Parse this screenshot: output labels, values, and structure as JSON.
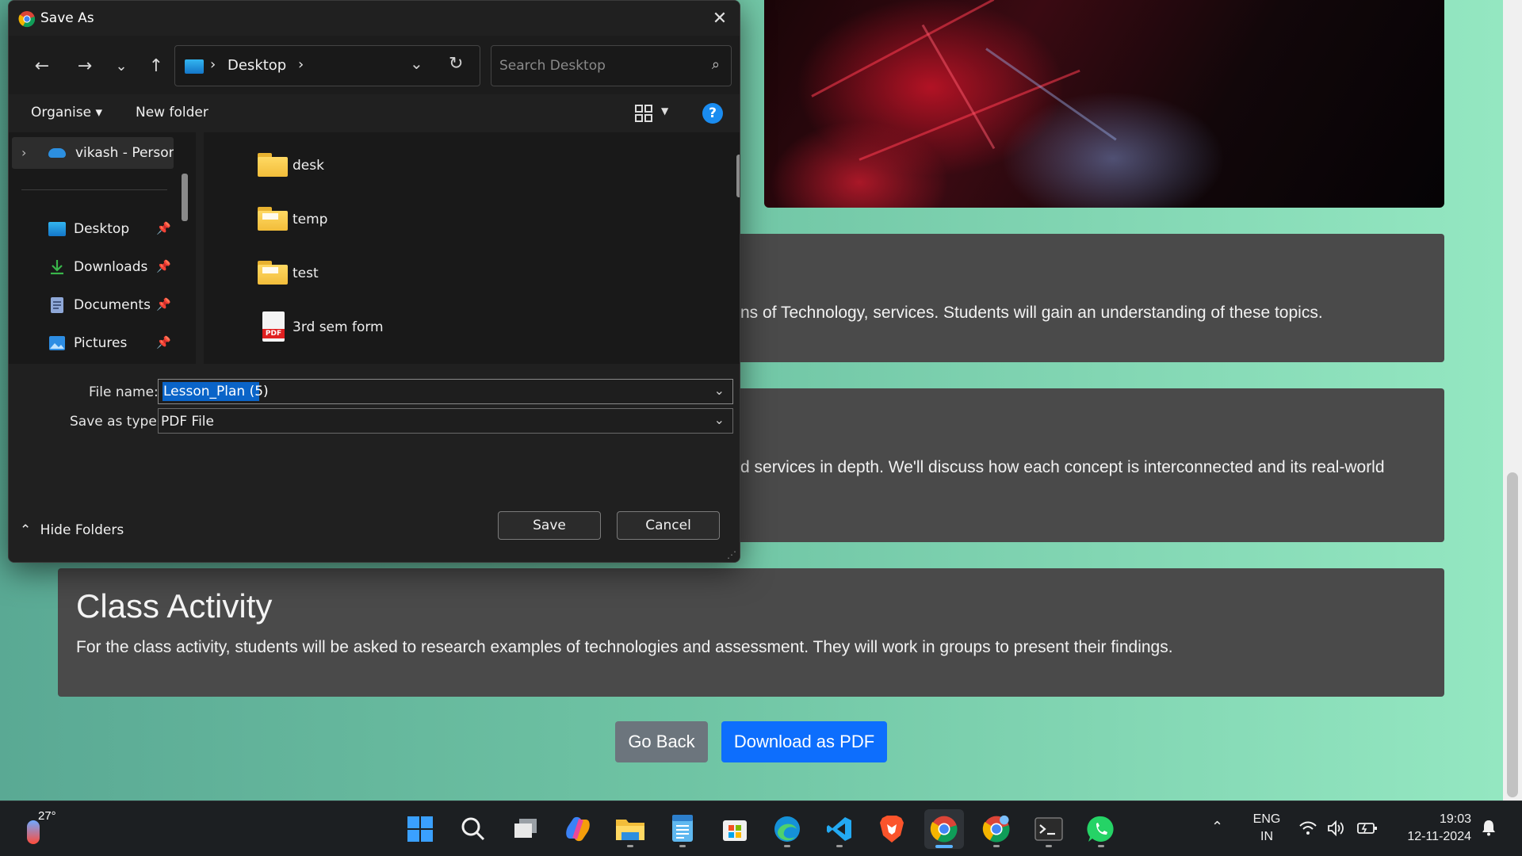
{
  "webpage": {
    "card1_text": "ns of Technology, services. Students will gain an understanding of these topics.",
    "card2_text": "d services in depth. We'll discuss how each concept is interconnected and its real-world",
    "card3_title": "Class Activity",
    "card3_text": "For the class activity, students will be asked to research examples of technologies and assessment. They will work in groups to present their findings.",
    "go_back_label": "Go Back",
    "download_label": "Download as PDF",
    "colors": {
      "card_bg": "#4a4a4a",
      "go_back_bg": "#6c757d",
      "download_bg": "#0d6efd"
    }
  },
  "dialog": {
    "title": "Save As",
    "close_glyph": "✕",
    "nav": {
      "back": "←",
      "forward": "→",
      "recent": "⌄",
      "up": "↑"
    },
    "address": {
      "location": "Desktop",
      "separator": "›"
    },
    "search": {
      "placeholder": "Search Desktop",
      "icon": "search-icon"
    },
    "toolbar": {
      "organise": "Organise ▾",
      "new_folder": "New folder",
      "help": "?"
    },
    "sidebar": {
      "onedrive_label": "vikash - Persona",
      "items": [
        {
          "label": "Desktop",
          "icon": "desktop-icon",
          "pinned": true
        },
        {
          "label": "Downloads",
          "icon": "downloads-icon",
          "pinned": true
        },
        {
          "label": "Documents",
          "icon": "documents-icon",
          "pinned": true
        },
        {
          "label": "Pictures",
          "icon": "pictures-icon",
          "pinned": true
        }
      ]
    },
    "files": [
      {
        "name": "desk",
        "type": "folder"
      },
      {
        "name": "temp",
        "type": "folder"
      },
      {
        "name": "test",
        "type": "folder"
      },
      {
        "name": "3rd sem form",
        "type": "pdf"
      }
    ],
    "pdf_badge": "PDF",
    "file_name_label": "File name:",
    "file_name_value": "Lesson_Plan (5)",
    "save_as_type_label": "Save as type:",
    "save_as_type_value": "PDF File",
    "hide_folders_label": "Hide Folders",
    "save_label": "Save",
    "cancel_label": "Cancel"
  },
  "taskbar": {
    "weather_temp": "27°",
    "apps": [
      "start-icon",
      "search-icon",
      "task-view-icon",
      "copilot-icon",
      "file-explorer-icon",
      "notepad-icon",
      "store-icon",
      "edge-icon",
      "vscode-icon",
      "brave-icon",
      "chrome-icon",
      "chrome-profile-icon",
      "terminal-icon",
      "whatsapp-icon"
    ],
    "active_app": "chrome-icon",
    "lang_line1": "ENG",
    "lang_line2": "IN",
    "time": "19:03",
    "date": "12-11-2024"
  }
}
